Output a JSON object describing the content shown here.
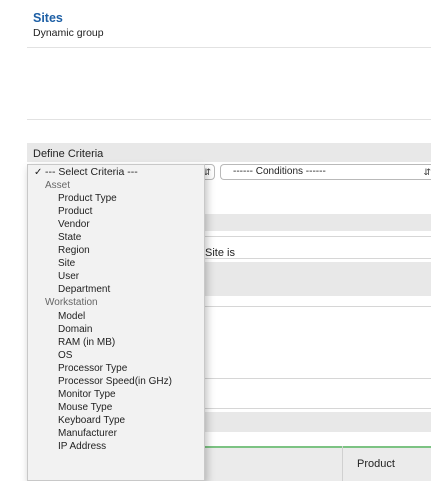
{
  "header": {
    "title": "Sites",
    "subtitle": "Dynamic group"
  },
  "criteria": {
    "section_label": "Define Criteria",
    "conditions_placeholder": "------ Conditions ------",
    "rule_text": "Site is"
  },
  "table": {
    "columns": [
      "Product"
    ]
  },
  "dropdown": {
    "selected": "--- Select Criteria ---",
    "groups": [
      {
        "label": "Asset",
        "options": [
          "Product Type",
          "Product",
          "Vendor",
          "State",
          "Region",
          "Site",
          "User",
          "Department"
        ]
      },
      {
        "label": "Workstation",
        "options": [
          "Model",
          "Domain",
          "RAM (in MB)",
          "OS",
          "Processor Type",
          "Processor Speed(in GHz)",
          "Monitor Type",
          "Mouse Type",
          "Keyboard Type",
          "Manufacturer",
          "IP Address"
        ]
      }
    ]
  },
  "icons": {
    "checkmark": "checkmark-icon",
    "select_arrows": "updown-arrows-icon"
  }
}
